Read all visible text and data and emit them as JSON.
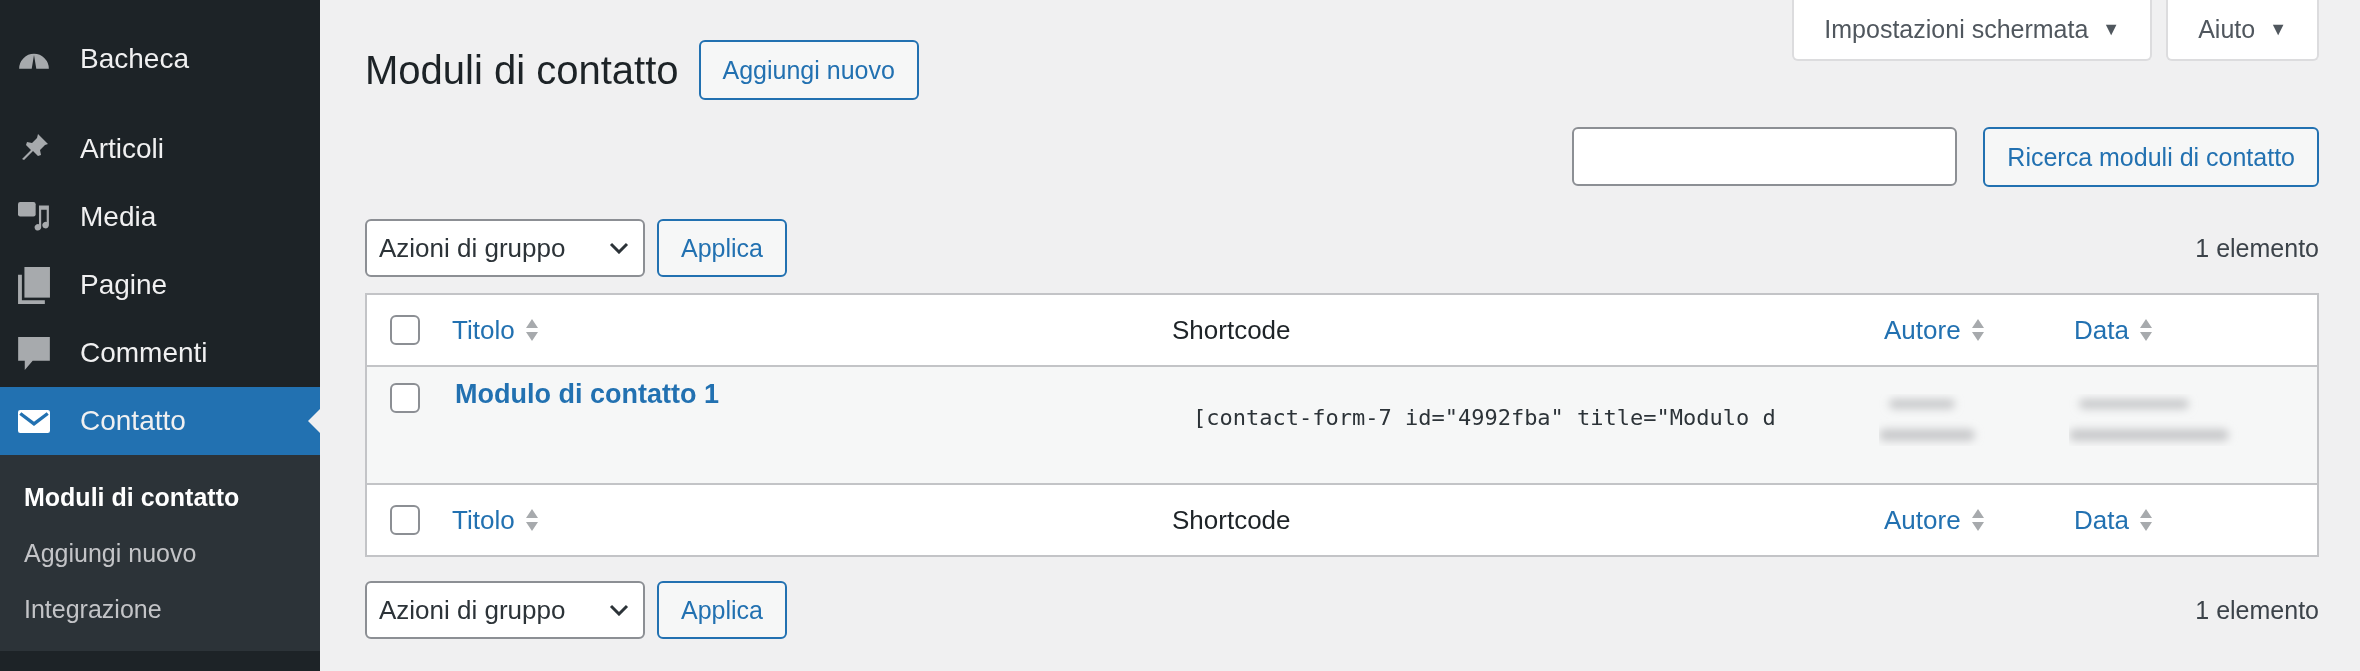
{
  "sidebar": {
    "items": [
      {
        "label": "Bacheca",
        "selected": false
      },
      {
        "label": "Articoli",
        "selected": false
      },
      {
        "label": "Media",
        "selected": false
      },
      {
        "label": "Pagine",
        "selected": false
      },
      {
        "label": "Commenti",
        "selected": false
      },
      {
        "label": "Contatto",
        "selected": true,
        "children": [
          {
            "label": "Moduli di contatto",
            "selected": true
          },
          {
            "label": "Aggiungi nuovo",
            "selected": false
          },
          {
            "label": "Integrazione",
            "selected": false
          }
        ]
      }
    ]
  },
  "screen_meta": [
    {
      "label": "Impostazioni schermata",
      "caret": "▼"
    },
    {
      "label": "Aiuto",
      "caret": "▼"
    }
  ],
  "heading": {
    "title": "Moduli di contatto",
    "add_button": "Aggiungi nuovo"
  },
  "search": {
    "button": "Ricerca moduli di contatto"
  },
  "bulk_top": {
    "select": "Azioni di gruppo",
    "apply": "Applica",
    "count": "1 elemento"
  },
  "table": {
    "header_columns": [
      {
        "label": "Titolo",
        "sortable": true
      },
      {
        "label": "Shortcode",
        "sortable": false
      },
      {
        "label": "Autore",
        "sortable": true
      },
      {
        "label": "Data",
        "sortable": true
      }
    ],
    "footer_columns": [
      {
        "label": "Titolo",
        "sortable": true
      },
      {
        "label": "Shortcode",
        "sortable": false
      },
      {
        "label": "Autore",
        "sortable": true
      },
      {
        "label": "Data",
        "sortable": true
      }
    ],
    "header_checked": false,
    "footer_checked": false,
    "rows": [
      {
        "checked": false,
        "title": "Modulo di contatto 1",
        "shortcode": "[contact-form-7 id=\"4992fba\" title=\"Modulo d",
        "author": {
          "kind": "blurred"
        },
        "date": {
          "kind": "blurred"
        }
      }
    ]
  },
  "bulk_bottom": {
    "select": "Azioni di gruppo",
    "apply": "Applica",
    "count": "1 elemento"
  }
}
